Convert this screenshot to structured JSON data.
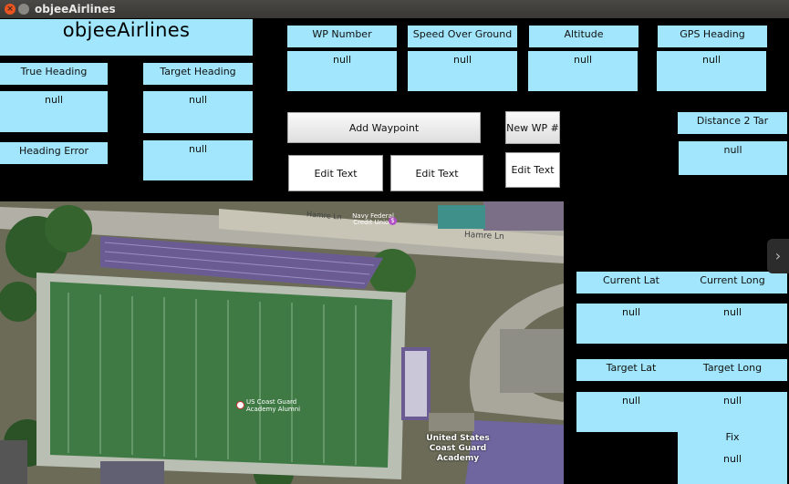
{
  "window": {
    "title": "objeeAirlines",
    "close_glyph": "×"
  },
  "app": {
    "name": "objeeAirlines"
  },
  "fields": {
    "true_heading": {
      "label": "True Heading",
      "value": "null"
    },
    "target_heading": {
      "label": "Target Heading",
      "value": "null"
    },
    "heading_error": {
      "label": "Heading Error",
      "value": "null"
    },
    "wp_number": {
      "label": "WP Number",
      "value": "null"
    },
    "speed_over_ground": {
      "label": "Speed Over Ground",
      "value": "null"
    },
    "altitude": {
      "label": "Altitude",
      "value": "null"
    },
    "gps_heading": {
      "label": "GPS Heading",
      "value": "null"
    },
    "distance_to_target": {
      "label": "Distance 2 Tar",
      "value": "null"
    },
    "current_lat": {
      "label": "Current Lat",
      "value": "null"
    },
    "current_long": {
      "label": "Current Long",
      "value": "null"
    },
    "target_lat": {
      "label": "Target Lat",
      "value": "null"
    },
    "target_long": {
      "label": "Target Long",
      "value": "null"
    },
    "fix": {
      "label": "Fix",
      "value": "null"
    }
  },
  "buttons": {
    "add_waypoint": "Add Waypoint",
    "new_wp": "New WP #",
    "edit_text_1": "Edit Text",
    "edit_text_2": "Edit Text",
    "edit_text_3": "Edit Text"
  },
  "map": {
    "labels": {
      "credit_union": "Navy Federal\nCredit Union",
      "street_1": "Hamre Ln",
      "street_2": "Hamre Ln",
      "alumni": "US Coast Guard\nAcademy Alumni",
      "academy": "United States\nCoast Guard\nAcademy"
    },
    "colors": {
      "field": "#3f7a45",
      "track": "#b9bfb3",
      "bleachers": "#6a5c93",
      "trees": "#2f5a2a"
    }
  },
  "side_tab_glyph": "›"
}
